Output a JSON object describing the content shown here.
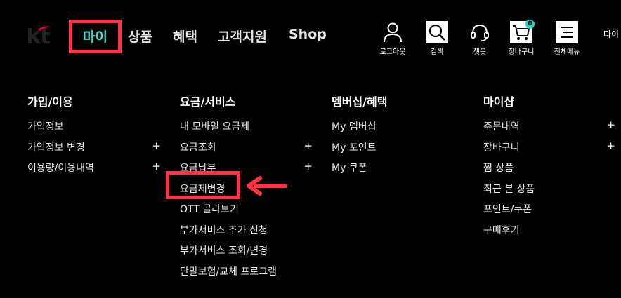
{
  "header": {
    "logo_icon": "kt-logo",
    "nav": [
      "마이",
      "상품",
      "혜택",
      "고객지원",
      "Shop"
    ],
    "utilities": [
      {
        "icon": "user-icon",
        "label": "로그아웃"
      },
      {
        "icon": "search-icon",
        "label": "검색"
      },
      {
        "icon": "chatbot-headset-icon",
        "label": "챗봇"
      },
      {
        "icon": "cart-icon",
        "label": "장바구니",
        "badge": "0"
      },
      {
        "icon": "menu-icon",
        "label": "전체메뉴"
      }
    ],
    "partial_text": "다이"
  },
  "menu": {
    "columns": [
      {
        "title": "가입/이용",
        "items": [
          {
            "label": "가입정보",
            "plus": ""
          },
          {
            "label": "가입정보 변경",
            "plus": "+"
          },
          {
            "label": "이용량/이용내역",
            "plus": "+"
          }
        ]
      },
      {
        "title": "요금/서비스",
        "items": [
          {
            "label": "내 모바일 요금제",
            "plus": ""
          },
          {
            "label": "요금조회",
            "plus": "+"
          },
          {
            "label": "요금납부",
            "plus": "+"
          },
          {
            "label": "요금제변경",
            "plus": ""
          },
          {
            "label": "OTT 골라보기",
            "plus": ""
          },
          {
            "label": "부가서비스 추가 신청",
            "plus": ""
          },
          {
            "label": "부가서비스 조회/변경",
            "plus": ""
          },
          {
            "label": "단말보험/교체 프로그램",
            "plus": ""
          }
        ]
      },
      {
        "title": "멤버십/혜택",
        "items": [
          {
            "label": "My 멤버십",
            "plus": ""
          },
          {
            "label": "My 포인트",
            "plus": ""
          },
          {
            "label": "My 쿠폰",
            "plus": ""
          }
        ]
      },
      {
        "title": "마이샵",
        "items": [
          {
            "label": "주문내역",
            "plus": "+"
          },
          {
            "label": "장바구니",
            "plus": "+"
          },
          {
            "label": "찜 상품",
            "plus": ""
          },
          {
            "label": "최근 본 상품",
            "plus": ""
          },
          {
            "label": "포인트/쿠폰",
            "plus": ""
          },
          {
            "label": "구매후기",
            "plus": ""
          }
        ]
      }
    ]
  },
  "annotation": {
    "highlight_color": "#ff3344",
    "active_nav_color": "#3fe0d0",
    "arrow_icon": "left-arrow-icon"
  }
}
